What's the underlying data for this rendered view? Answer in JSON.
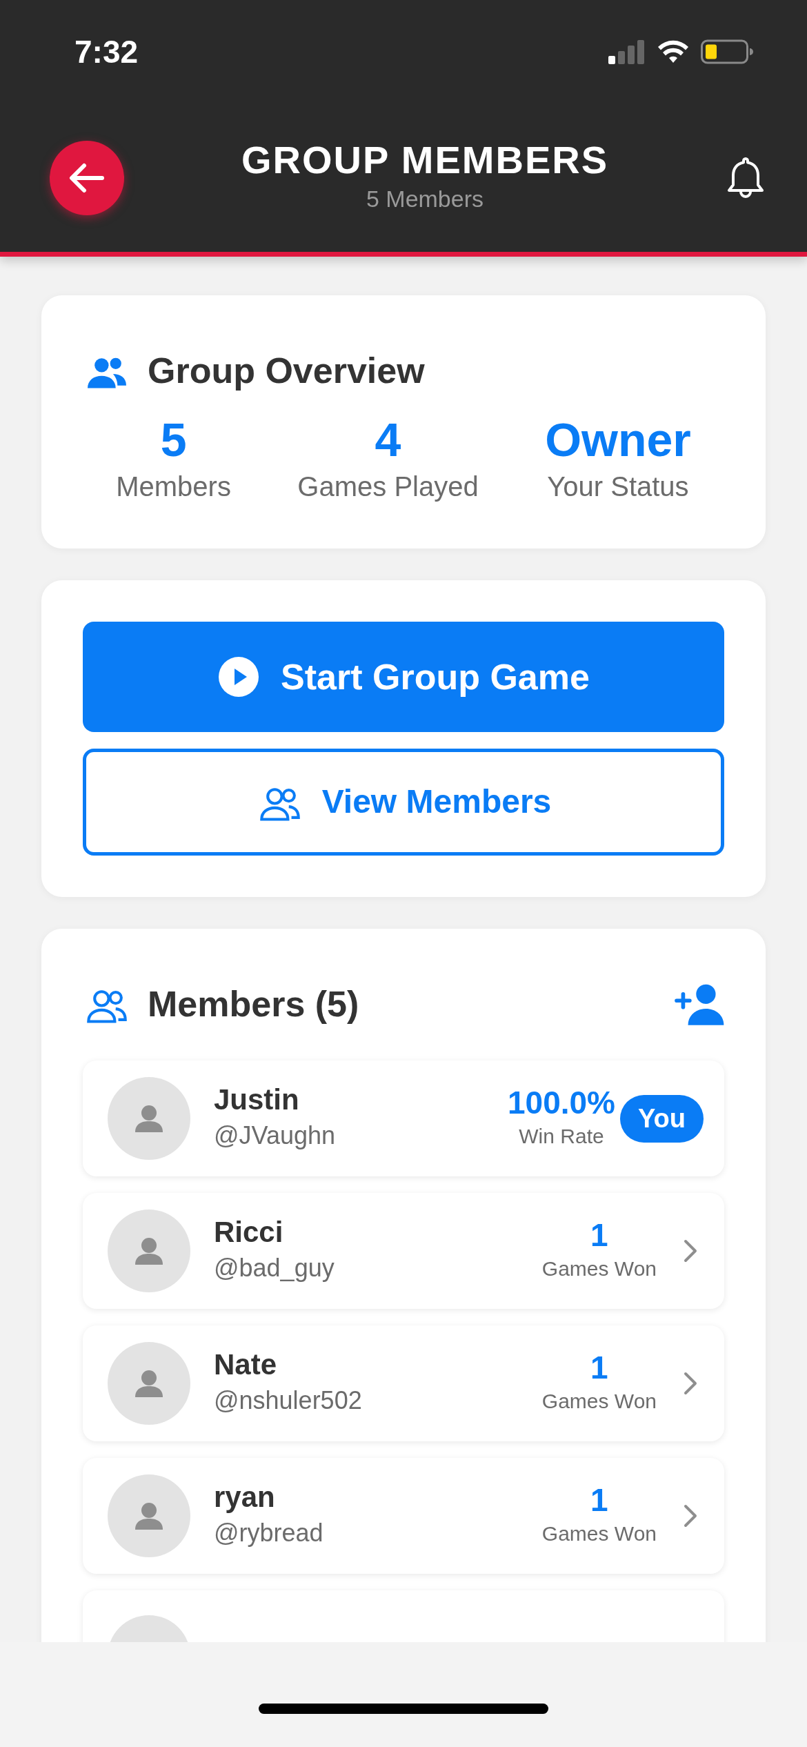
{
  "status_bar": {
    "time": "7:32"
  },
  "header": {
    "title": "GROUP MEMBERS",
    "subtitle": "5 Members"
  },
  "overview": {
    "title": "Group Overview",
    "stats": [
      {
        "value": "5",
        "label": "Members"
      },
      {
        "value": "4",
        "label": "Games Played"
      },
      {
        "value": "Owner",
        "label": "Your Status"
      }
    ]
  },
  "actions": [
    {
      "label": "Start Group Game",
      "kind": "primary"
    },
    {
      "label": "View Members",
      "kind": "outline"
    }
  ],
  "members": {
    "title": "Members (5)",
    "more_rows_below": true,
    "list": [
      {
        "name": "Justin",
        "handle": "@JVaughn",
        "stat_value": "100.0%",
        "stat_label": "Win Rate",
        "is_you": true,
        "badge": "You"
      },
      {
        "name": "Ricci",
        "handle": "@bad_guy",
        "stat_value": "1",
        "stat_label": "Games Won",
        "is_you": false
      },
      {
        "name": "Nate",
        "handle": "@nshuler502",
        "stat_value": "1",
        "stat_label": "Games Won",
        "is_you": false
      },
      {
        "name": "ryan",
        "handle": "@rybread",
        "stat_value": "1",
        "stat_label": "Games Won",
        "is_you": false
      }
    ]
  }
}
